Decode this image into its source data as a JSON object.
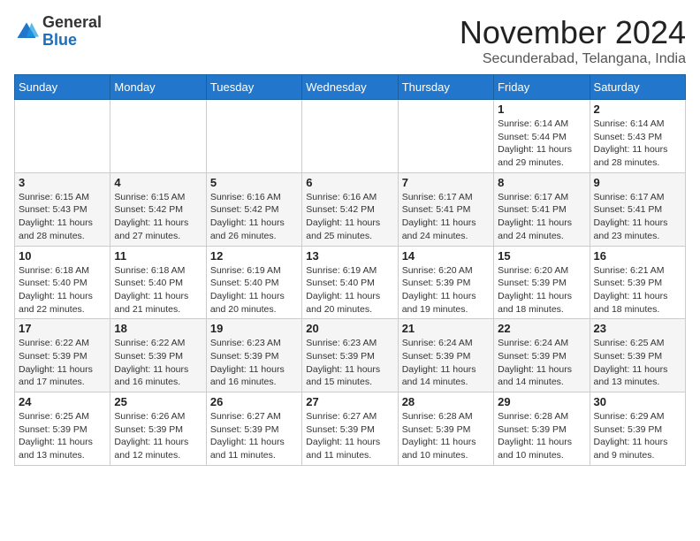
{
  "header": {
    "logo_line1": "General",
    "logo_line2": "Blue",
    "month_title": "November 2024",
    "subtitle": "Secunderabad, Telangana, India"
  },
  "columns": [
    "Sunday",
    "Monday",
    "Tuesday",
    "Wednesday",
    "Thursday",
    "Friday",
    "Saturday"
  ],
  "weeks": [
    [
      {
        "day": "",
        "info": ""
      },
      {
        "day": "",
        "info": ""
      },
      {
        "day": "",
        "info": ""
      },
      {
        "day": "",
        "info": ""
      },
      {
        "day": "",
        "info": ""
      },
      {
        "day": "1",
        "info": "Sunrise: 6:14 AM\nSunset: 5:44 PM\nDaylight: 11 hours\nand 29 minutes."
      },
      {
        "day": "2",
        "info": "Sunrise: 6:14 AM\nSunset: 5:43 PM\nDaylight: 11 hours\nand 28 minutes."
      }
    ],
    [
      {
        "day": "3",
        "info": "Sunrise: 6:15 AM\nSunset: 5:43 PM\nDaylight: 11 hours\nand 28 minutes."
      },
      {
        "day": "4",
        "info": "Sunrise: 6:15 AM\nSunset: 5:42 PM\nDaylight: 11 hours\nand 27 minutes."
      },
      {
        "day": "5",
        "info": "Sunrise: 6:16 AM\nSunset: 5:42 PM\nDaylight: 11 hours\nand 26 minutes."
      },
      {
        "day": "6",
        "info": "Sunrise: 6:16 AM\nSunset: 5:42 PM\nDaylight: 11 hours\nand 25 minutes."
      },
      {
        "day": "7",
        "info": "Sunrise: 6:17 AM\nSunset: 5:41 PM\nDaylight: 11 hours\nand 24 minutes."
      },
      {
        "day": "8",
        "info": "Sunrise: 6:17 AM\nSunset: 5:41 PM\nDaylight: 11 hours\nand 24 minutes."
      },
      {
        "day": "9",
        "info": "Sunrise: 6:17 AM\nSunset: 5:41 PM\nDaylight: 11 hours\nand 23 minutes."
      }
    ],
    [
      {
        "day": "10",
        "info": "Sunrise: 6:18 AM\nSunset: 5:40 PM\nDaylight: 11 hours\nand 22 minutes."
      },
      {
        "day": "11",
        "info": "Sunrise: 6:18 AM\nSunset: 5:40 PM\nDaylight: 11 hours\nand 21 minutes."
      },
      {
        "day": "12",
        "info": "Sunrise: 6:19 AM\nSunset: 5:40 PM\nDaylight: 11 hours\nand 20 minutes."
      },
      {
        "day": "13",
        "info": "Sunrise: 6:19 AM\nSunset: 5:40 PM\nDaylight: 11 hours\nand 20 minutes."
      },
      {
        "day": "14",
        "info": "Sunrise: 6:20 AM\nSunset: 5:39 PM\nDaylight: 11 hours\nand 19 minutes."
      },
      {
        "day": "15",
        "info": "Sunrise: 6:20 AM\nSunset: 5:39 PM\nDaylight: 11 hours\nand 18 minutes."
      },
      {
        "day": "16",
        "info": "Sunrise: 6:21 AM\nSunset: 5:39 PM\nDaylight: 11 hours\nand 18 minutes."
      }
    ],
    [
      {
        "day": "17",
        "info": "Sunrise: 6:22 AM\nSunset: 5:39 PM\nDaylight: 11 hours\nand 17 minutes."
      },
      {
        "day": "18",
        "info": "Sunrise: 6:22 AM\nSunset: 5:39 PM\nDaylight: 11 hours\nand 16 minutes."
      },
      {
        "day": "19",
        "info": "Sunrise: 6:23 AM\nSunset: 5:39 PM\nDaylight: 11 hours\nand 16 minutes."
      },
      {
        "day": "20",
        "info": "Sunrise: 6:23 AM\nSunset: 5:39 PM\nDaylight: 11 hours\nand 15 minutes."
      },
      {
        "day": "21",
        "info": "Sunrise: 6:24 AM\nSunset: 5:39 PM\nDaylight: 11 hours\nand 14 minutes."
      },
      {
        "day": "22",
        "info": "Sunrise: 6:24 AM\nSunset: 5:39 PM\nDaylight: 11 hours\nand 14 minutes."
      },
      {
        "day": "23",
        "info": "Sunrise: 6:25 AM\nSunset: 5:39 PM\nDaylight: 11 hours\nand 13 minutes."
      }
    ],
    [
      {
        "day": "24",
        "info": "Sunrise: 6:25 AM\nSunset: 5:39 PM\nDaylight: 11 hours\nand 13 minutes."
      },
      {
        "day": "25",
        "info": "Sunrise: 6:26 AM\nSunset: 5:39 PM\nDaylight: 11 hours\nand 12 minutes."
      },
      {
        "day": "26",
        "info": "Sunrise: 6:27 AM\nSunset: 5:39 PM\nDaylight: 11 hours\nand 11 minutes."
      },
      {
        "day": "27",
        "info": "Sunrise: 6:27 AM\nSunset: 5:39 PM\nDaylight: 11 hours\nand 11 minutes."
      },
      {
        "day": "28",
        "info": "Sunrise: 6:28 AM\nSunset: 5:39 PM\nDaylight: 11 hours\nand 10 minutes."
      },
      {
        "day": "29",
        "info": "Sunrise: 6:28 AM\nSunset: 5:39 PM\nDaylight: 11 hours\nand 10 minutes."
      },
      {
        "day": "30",
        "info": "Sunrise: 6:29 AM\nSunset: 5:39 PM\nDaylight: 11 hours\nand 9 minutes."
      }
    ]
  ]
}
